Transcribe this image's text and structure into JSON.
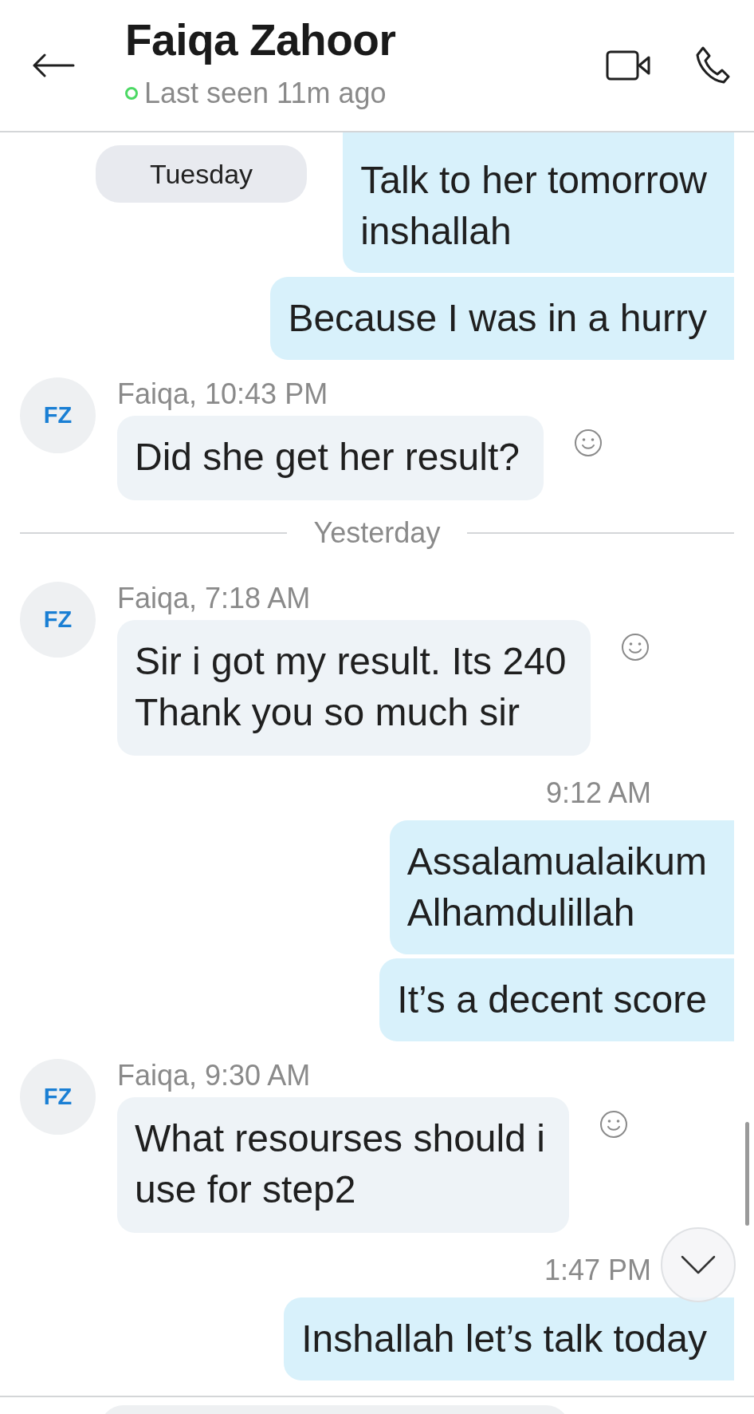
{
  "header": {
    "title": "Faiqa Zahoor",
    "online": true,
    "status": "Last seen 11m ago"
  },
  "floating_date": "Tuesday",
  "messages": [
    {
      "kind": "outgoing",
      "text": "Talk to her tomorrow\ninshallah"
    },
    {
      "kind": "outgoing",
      "text": "Because I was in a hurry"
    },
    {
      "kind": "incoming",
      "initials": "FZ",
      "meta": "Faiqa, 10:43 PM",
      "text": "Did she get her result?"
    },
    {
      "kind": "divider",
      "label": "Yesterday"
    },
    {
      "kind": "incoming",
      "initials": "FZ",
      "meta": "Faiqa, 7:18 AM",
      "text": "Sir i got my result. Its 240\nThank you so much sir"
    },
    {
      "kind": "outgoing",
      "time": "9:12 AM",
      "text": "Assalamualaikum\nAlhamdulillah"
    },
    {
      "kind": "outgoing",
      "text": "It’s a decent score"
    },
    {
      "kind": "incoming",
      "initials": "FZ",
      "meta": "Faiqa, 9:30 AM",
      "text": "What resourses should i\nuse for step2"
    },
    {
      "kind": "outgoing",
      "time": "1:47 PM",
      "text": "Inshallah let’s talk today"
    }
  ]
}
